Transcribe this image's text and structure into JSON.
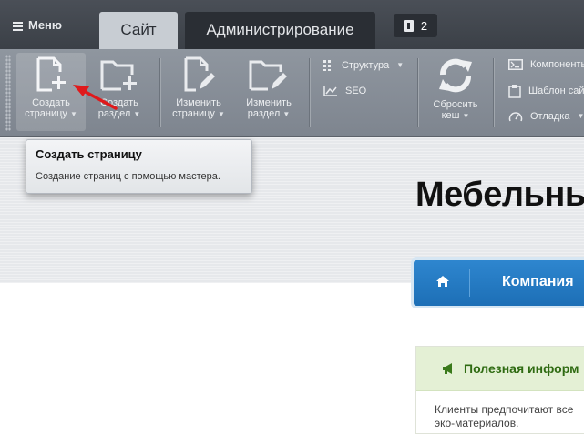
{
  "topbar": {
    "menu_label": "Меню",
    "tabs": [
      {
        "label": "Сайт",
        "active": true
      },
      {
        "label": "Администрирование",
        "active": false
      }
    ],
    "notifications_count": "2"
  },
  "toolbar": {
    "create_page": {
      "line1": "Создать",
      "line2": "страницу"
    },
    "create_section": {
      "line1": "Создать",
      "line2": "раздел"
    },
    "edit_page": {
      "line1": "Изменить",
      "line2": "страницу"
    },
    "edit_section": {
      "line1": "Изменить",
      "line2": "раздел"
    },
    "structure": "Структура",
    "seo": "SEO",
    "reset_cache": {
      "line1": "Сбросить",
      "line2": "кеш"
    },
    "components": "Компоненты",
    "site_template": "Шаблон сайта",
    "debug": "Отладка"
  },
  "tooltip": {
    "title": "Создать страницу",
    "text": "Создание страниц с помощью мастера."
  },
  "site": {
    "title": "Мебельны",
    "nav_link": "Компания",
    "info_title": "Полезная информ",
    "info_text": "Клиенты предпочитают все\nэко-материалов."
  },
  "colors": {
    "topbar": "#3f444b",
    "toolbar": "#878e97",
    "nav_blue": "#2479c2",
    "info_green": "#2f6b12",
    "arrow_red": "#e0191b"
  }
}
